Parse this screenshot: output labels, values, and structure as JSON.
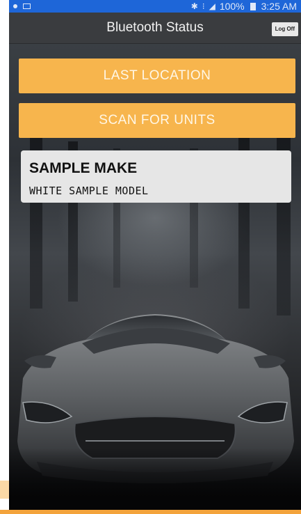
{
  "status_bar": {
    "battery_percent": "100%",
    "time": "3:25 AM",
    "icons": [
      "notification-dot-icon",
      "image-icon",
      "bluetooth-icon",
      "vibrate-icon",
      "signal-icon",
      "battery-icon"
    ]
  },
  "header": {
    "title": "Bluetooth Status",
    "logoff_label": "Log Off"
  },
  "buttons": {
    "last_location": "LAST LOCATION",
    "scan_for_units": "SCAN FOR UNITS"
  },
  "vehicle": {
    "make": "SAMPLE MAKE",
    "model": "WHITE SAMPLE MODEL"
  },
  "colors": {
    "status_bar": "#1e66d8",
    "title_bar": "#3a3c3f",
    "accent_button": "#f7b54d",
    "card_background": "#e6e6e6"
  }
}
